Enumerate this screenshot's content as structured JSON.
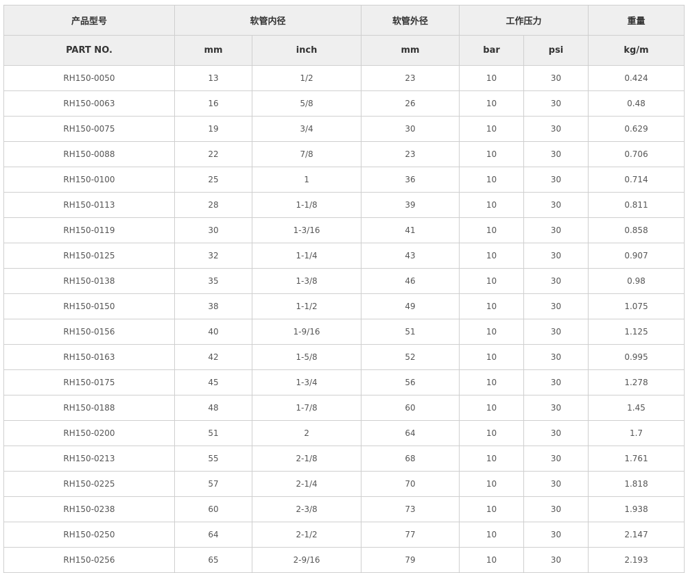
{
  "header": {
    "row1": [
      "产品型号",
      "软管内径",
      "软管外径",
      "工作压力",
      "重量"
    ],
    "row2": [
      "PART NO.",
      "mm",
      "inch",
      "mm",
      "bar",
      "psi",
      "kg/m"
    ]
  },
  "rows": [
    [
      "RH150-0050",
      "13",
      "1/2",
      "23",
      "10",
      "30",
      "0.424"
    ],
    [
      "RH150-0063",
      "16",
      "5/8",
      "26",
      "10",
      "30",
      "0.48"
    ],
    [
      "RH150-0075",
      "19",
      "3/4",
      "30",
      "10",
      "30",
      "0.629"
    ],
    [
      "RH150-0088",
      "22",
      "7/8",
      "23",
      "10",
      "30",
      "0.706"
    ],
    [
      "RH150-0100",
      "25",
      "1",
      "36",
      "10",
      "30",
      "0.714"
    ],
    [
      "RH150-0113",
      "28",
      "1-1/8",
      "39",
      "10",
      "30",
      "0.811"
    ],
    [
      "RH150-0119",
      "30",
      "1-3/16",
      "41",
      "10",
      "30",
      "0.858"
    ],
    [
      "RH150-0125",
      "32",
      "1-1/4",
      "43",
      "10",
      "30",
      "0.907"
    ],
    [
      "RH150-0138",
      "35",
      "1-3/8",
      "46",
      "10",
      "30",
      "0.98"
    ],
    [
      "RH150-0150",
      "38",
      "1-1/2",
      "49",
      "10",
      "30",
      "1.075"
    ],
    [
      "RH150-0156",
      "40",
      "1-9/16",
      "51",
      "10",
      "30",
      "1.125"
    ],
    [
      "RH150-0163",
      "42",
      "1-5/8",
      "52",
      "10",
      "30",
      "0.995"
    ],
    [
      "RH150-0175",
      "45",
      "1-3/4",
      "56",
      "10",
      "30",
      "1.278"
    ],
    [
      "RH150-0188",
      "48",
      "1-7/8",
      "60",
      "10",
      "30",
      "1.45"
    ],
    [
      "RH150-0200",
      "51",
      "2",
      "64",
      "10",
      "30",
      "1.7"
    ],
    [
      "RH150-0213",
      "55",
      "2-1/8",
      "68",
      "10",
      "30",
      "1.761"
    ],
    [
      "RH150-0225",
      "57",
      "2-1/4",
      "70",
      "10",
      "30",
      "1.818"
    ],
    [
      "RH150-0238",
      "60",
      "2-3/8",
      "73",
      "10",
      "30",
      "1.938"
    ],
    [
      "RH150-0250",
      "64",
      "2-1/2",
      "77",
      "10",
      "30",
      "2.147"
    ],
    [
      "RH150-0256",
      "65",
      "2-9/16",
      "79",
      "10",
      "30",
      "2.193"
    ]
  ]
}
